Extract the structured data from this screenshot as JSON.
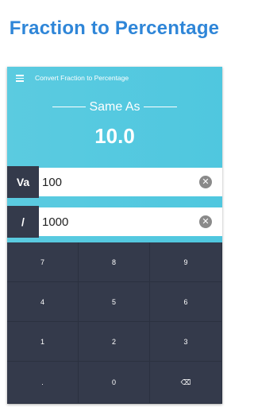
{
  "banner": {
    "title": "Fraction to Percentage"
  },
  "appbar": {
    "title": "Convert Fraction to Percentage"
  },
  "result": {
    "label": "Same As",
    "value": "10.0"
  },
  "inputs": [
    {
      "label": "Va",
      "value": "100",
      "clear_icon": "clear-circle-icon"
    },
    {
      "label": "/",
      "value": "1000",
      "clear_icon": "clear-circle-icon"
    }
  ],
  "keypad": {
    "keys": [
      "7",
      "8",
      "9",
      "4",
      "5",
      "6",
      "1",
      "2",
      "3",
      ".",
      "0",
      "⌫"
    ]
  },
  "colors": {
    "banner_text": "#2f86d8",
    "header_bg": "#4fc7df",
    "keypad_bg": "#343a4b"
  }
}
